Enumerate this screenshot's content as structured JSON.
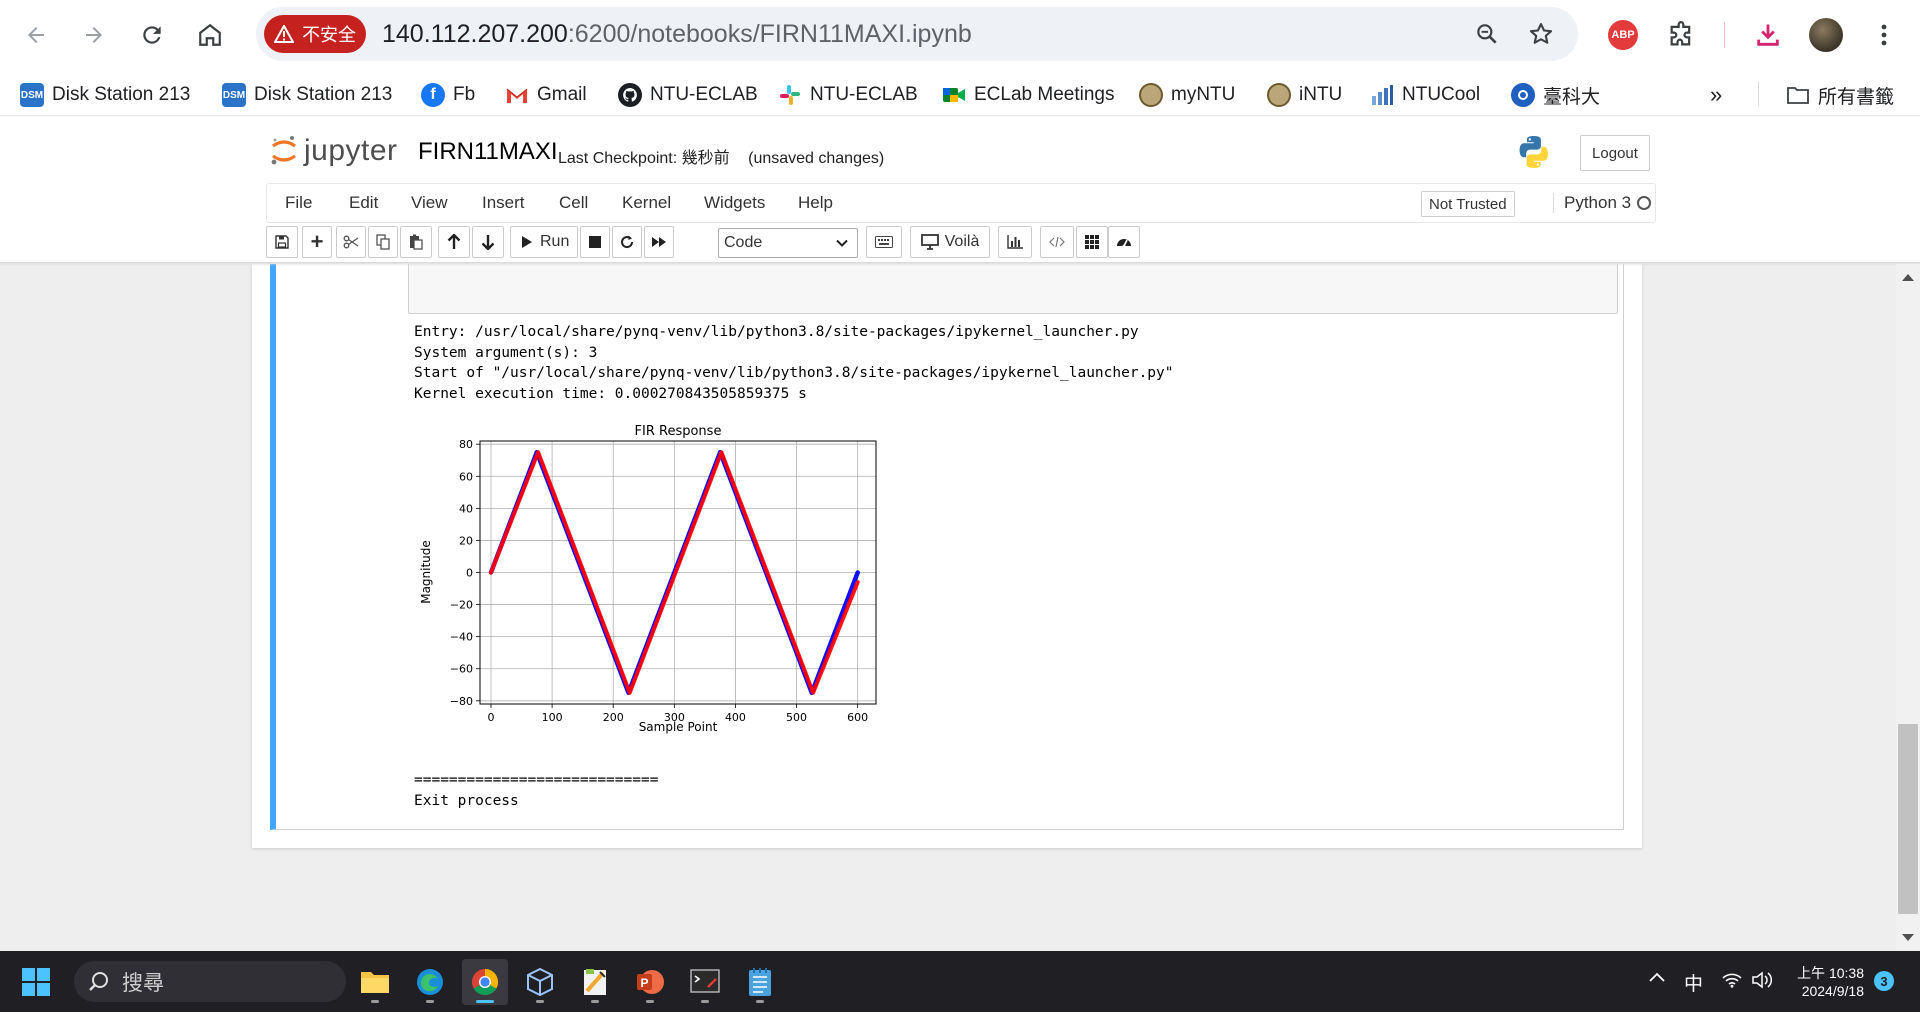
{
  "browser": {
    "security_label": "不安全",
    "url_host": "140.112.207.200",
    "url_rest": ":6200/notebooks/FIRN11MAXI.ipynb",
    "extension_label": "ABP"
  },
  "bookmarks": [
    {
      "label": "Disk Station  213",
      "icon": "dsm-icon",
      "icon_text": "DSM"
    },
    {
      "label": "Disk Station 213",
      "icon": "dsm-icon",
      "icon_text": "DSM"
    },
    {
      "label": "Fb",
      "icon": "facebook-icon"
    },
    {
      "label": "Gmail",
      "icon": "gmail-icon"
    },
    {
      "label": "NTU-ECLAB",
      "icon": "github-icon"
    },
    {
      "label": "NTU-ECLAB",
      "icon": "slack-icon"
    },
    {
      "label": "ECLab Meetings",
      "icon": "google-meet-icon"
    },
    {
      "label": "myNTU",
      "icon": "ntu-seal-icon"
    },
    {
      "label": "iNTU",
      "icon": "ntu-seal-icon"
    },
    {
      "label": "NTUCool",
      "icon": "ntucool-icon"
    },
    {
      "label": "臺科大",
      "icon": "ntust-icon"
    }
  ],
  "bookmarks_folder": "所有書籤",
  "jupyter": {
    "logo_text": "jupyter",
    "notebook_name": "FIRN11MAXI",
    "checkpoint_label": "Last Checkpoint:",
    "checkpoint_time": "幾秒前",
    "unsaved": "(unsaved changes)",
    "logout": "Logout",
    "trust_status": "Not Trusted",
    "kernel_name": "Python 3"
  },
  "menu": [
    "File",
    "Edit",
    "View",
    "Insert",
    "Cell",
    "Kernel",
    "Widgets",
    "Help"
  ],
  "toolbar": {
    "run_label": "Run",
    "cell_type": "Code",
    "voila_label": "Voilà"
  },
  "output": {
    "lines": [
      "Entry: /usr/local/share/pynq-venv/lib/python3.8/site-packages/ipykernel_launcher.py",
      "System argument(s): 3",
      "Start of \"/usr/local/share/pynq-venv/lib/python3.8/site-packages/ipykernel_launcher.py\"",
      "Kernel execution time: 0.000270843505859375 s"
    ],
    "separator": "============================",
    "exit_line": "Exit process"
  },
  "chart_data": {
    "type": "line",
    "title": "FIR Response",
    "xlabel": "Sample Point",
    "ylabel": "Magnitude",
    "xlim": [
      -18,
      630
    ],
    "ylim": [
      -82,
      82
    ],
    "xticks": [
      0,
      100,
      200,
      300,
      400,
      500,
      600
    ],
    "yticks": [
      -80,
      -60,
      -40,
      -20,
      0,
      20,
      40,
      60,
      80
    ],
    "grid": true,
    "series": [
      {
        "color": "#0000ff",
        "x": [
          0,
          75,
          225,
          375,
          525,
          600
        ],
        "y": [
          0,
          75,
          -75,
          75,
          -75,
          0
        ]
      },
      {
        "color": "#ff0000",
        "x": [
          0,
          77,
          227,
          377,
          527,
          600
        ],
        "y": [
          0,
          75,
          -75,
          75,
          -75,
          -6
        ]
      }
    ]
  },
  "taskbar": {
    "search_placeholder": "搜尋",
    "ime": "中",
    "time": "上午 10:38",
    "date": "2024/9/18",
    "notifications": "3"
  }
}
